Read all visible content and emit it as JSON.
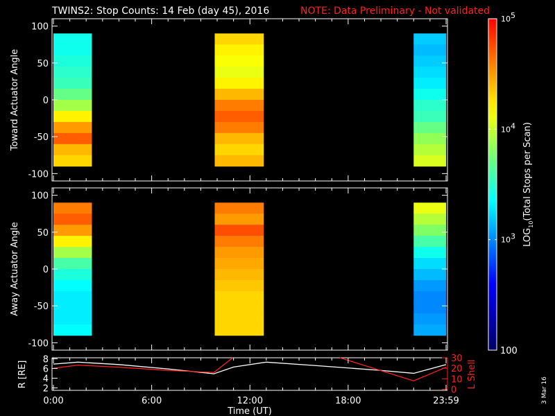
{
  "title": {
    "main": "TWINS2: Stop Counts: 14 Feb (day  45), 2016",
    "note": "NOTE: Data Preliminary - Not validated"
  },
  "footer_date": "3 Mar 16",
  "chart_data": [
    {
      "type": "heatmap",
      "name": "toward",
      "ylabel": "Toward Actuator Angle",
      "ylim": [
        -110,
        110
      ],
      "yticks": [
        "100",
        "50",
        "0",
        "-50",
        "-100"
      ],
      "ytick_values": [
        100,
        50,
        0,
        -50,
        -100
      ],
      "angle_bins": [
        82.5,
        67.5,
        52.5,
        37.5,
        22.5,
        7.5,
        -7.5,
        -22.5,
        -37.5,
        -52.5,
        -67.5,
        -82.5
      ],
      "segments": [
        {
          "t_start": 0.0,
          "t_end": 2.35,
          "log_values": [
            3.4,
            3.4,
            3.45,
            3.5,
            3.55,
            3.7,
            3.9,
            4.2,
            4.5,
            4.7,
            4.4,
            4.3
          ]
        },
        {
          "t_start": 9.85,
          "t_end": 12.85,
          "log_values": [
            4.3,
            4.2,
            4.15,
            4.1,
            4.2,
            4.4,
            4.6,
            4.7,
            4.6,
            4.4,
            4.3,
            4.4
          ]
        },
        {
          "t_start": 22.0,
          "t_end": 23.98,
          "log_values": [
            3.2,
            3.15,
            3.2,
            3.25,
            3.3,
            3.4,
            3.5,
            3.55,
            3.7,
            3.85,
            3.95,
            4.05
          ]
        }
      ]
    },
    {
      "type": "heatmap",
      "name": "away",
      "ylabel": "Away Actuator Angle",
      "ylim": [
        -110,
        110
      ],
      "yticks": [
        "100",
        "50",
        "0",
        "-50",
        "-100"
      ],
      "ytick_values": [
        100,
        50,
        0,
        -50,
        -100
      ],
      "angle_bins": [
        82.5,
        67.5,
        52.5,
        37.5,
        22.5,
        7.5,
        -7.5,
        -22.5,
        -37.5,
        -52.5,
        -67.5,
        -82.5
      ],
      "segments": [
        {
          "t_start": 0.0,
          "t_end": 2.35,
          "log_values": [
            4.6,
            4.7,
            4.5,
            4.2,
            3.9,
            3.6,
            3.45,
            3.35,
            3.3,
            3.3,
            3.3,
            3.35
          ]
        },
        {
          "t_start": 9.85,
          "t_end": 12.85,
          "log_values": [
            4.6,
            4.5,
            4.75,
            4.6,
            4.5,
            4.45,
            4.4,
            4.35,
            4.3,
            4.3,
            4.3,
            4.3
          ]
        },
        {
          "t_start": 22.0,
          "t_end": 23.98,
          "log_values": [
            4.1,
            3.95,
            3.8,
            3.6,
            3.4,
            3.25,
            3.15,
            3.05,
            3.0,
            3.0,
            3.05,
            3.1
          ]
        }
      ]
    },
    {
      "type": "line",
      "name": "orbit",
      "ylabel": "R [RE]",
      "y2label": "L Shell",
      "xlabel": "Time (UT)",
      "xlim": [
        0,
        24
      ],
      "xticks": [
        "0:00",
        "6:00",
        "12:00",
        "18:00",
        "23:59"
      ],
      "xtick_values": [
        0,
        6,
        12,
        18,
        23.98
      ],
      "ylim": [
        1.5,
        8.2
      ],
      "yticks": [
        "8",
        "6",
        "4",
        "2"
      ],
      "ytick_values": [
        8,
        6,
        4,
        2
      ],
      "y2lim": [
        -1,
        30
      ],
      "y2ticks": [
        "30",
        "20",
        "10",
        "0"
      ],
      "y2tick_values": [
        30,
        20,
        10,
        0
      ],
      "series": [
        {
          "name": "R",
          "color": "#ffffff",
          "axis": "left",
          "x": [
            0,
            1.5,
            4,
            7,
            9.8,
            11,
            13,
            16,
            20,
            22,
            23.98
          ],
          "y": [
            6.9,
            7.3,
            6.8,
            5.9,
            4.9,
            6.3,
            7.3,
            6.6,
            5.6,
            5.0,
            6.8
          ]
        },
        {
          "name": "L Shell",
          "color": "#ff2020",
          "axis": "right",
          "x": [
            0,
            1.5,
            4,
            7,
            9.8,
            10.95
          ],
          "y": [
            20,
            23,
            21,
            18,
            16,
            30
          ]
        },
        {
          "name": "L Shell",
          "color": "#ff2020",
          "axis": "right",
          "x": [
            17.5,
            22,
            23.98
          ],
          "y": [
            30,
            8,
            21
          ]
        }
      ]
    },
    {
      "type": "colorbar",
      "label_prefix": "LOG",
      "label_sub": "10",
      "label_suffix": "(Total Stops per Scan)",
      "range_log": [
        2,
        5
      ],
      "ticks": [
        {
          "base": "10",
          "exp": "5",
          "log": 5
        },
        {
          "base": "10",
          "exp": "4",
          "log": 4
        },
        {
          "base": "10",
          "exp": "3",
          "log": 3
        }
      ],
      "bottom_label": "100"
    }
  ]
}
